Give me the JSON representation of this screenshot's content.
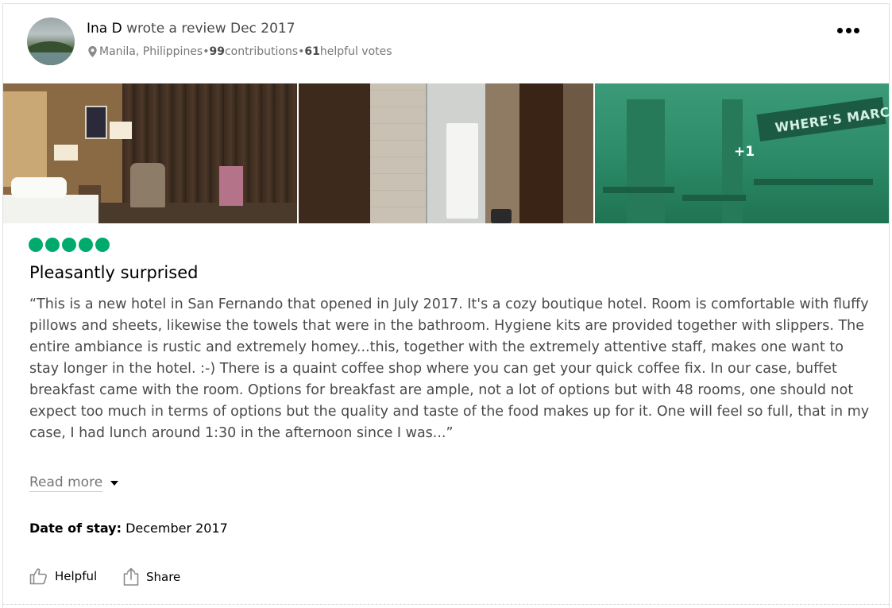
{
  "reviewer": {
    "name": "Ina D",
    "action": " wrote a review Dec 2017",
    "location": "Manila, Philippines",
    "sep1": " • ",
    "contributions_count": "99",
    "contributions_label": " contributions",
    "sep2": " • ",
    "votes_count": "61",
    "votes_label": " helpful votes"
  },
  "photos": {
    "extra_label": "+1",
    "sign_text": "WHERE'S MARCEL?"
  },
  "review": {
    "rating": 5,
    "rating_max": 5,
    "rating_color": "#00aa6c",
    "title": "Pleasantly surprised",
    "text": "“This is a new hotel in San Fernando that opened in July 2017. It's a cozy boutique hotel. Room is comfortable with fluffy pillows and sheets, likewise the towels that were in the bathroom. Hygiene kits are provided together with slippers. The entire ambiance is rustic and extremely homey...this, together with the extremely attentive staff, makes one want to stay longer in the hotel. :-) There is a quaint coffee shop where you can get your quick coffee fix. In our case, buffet breakfast came with the room. Options for breakfast are ample, not a lot of options but with 48 rooms, one should not expect too much in terms of options but the quality and taste of the food makes up for it. One will feel so full, that in my case, I had lunch around 1:30 in the afternoon since I was...”",
    "read_more": "Read more",
    "stay_label": "Date of stay:",
    "stay_value": " December 2017"
  },
  "actions": {
    "helpful": "Helpful",
    "share": "Share"
  },
  "icons": {
    "more": "more-options-icon",
    "location": "map-pin-icon",
    "helpful": "thumbs-up-icon",
    "share": "share-icon",
    "read_more": "caret-down-icon"
  }
}
